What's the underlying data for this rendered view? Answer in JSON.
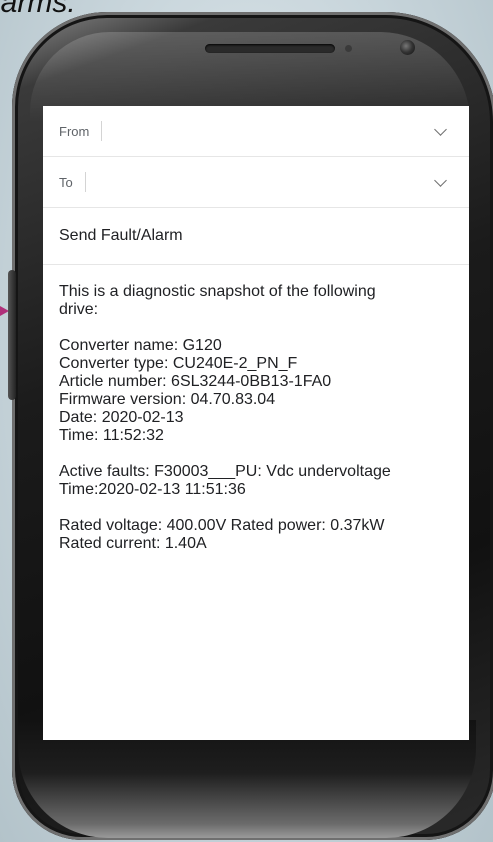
{
  "caption": "larms.",
  "email": {
    "from_label": "From",
    "to_label": "To",
    "subject": "Send Fault/Alarm",
    "body": {
      "intro_line1": "This is a diagnostic snapshot of the following",
      "intro_line2": "drive:",
      "converter_name": "Converter name: G120",
      "converter_type": "Converter type: CU240E-2_PN_F",
      "article_number": "Article number: 6SL3244-0BB13-1FA0",
      "firmware_version": "Firmware version: 04.70.83.04",
      "date": "Date: 2020-02-13",
      "time": "Time: 11:52:32",
      "active_faults": "Active faults: F30003___PU: Vdc undervoltage",
      "fault_time": "Time:2020-02-13 11:51:36",
      "rated_voltage_power": "Rated voltage: 400.00V Rated power: 0.37kW",
      "rated_current": "Rated current: 1.40A"
    }
  },
  "colors": {
    "background": "#c9d6dc",
    "phone_body": "#1b1b1b",
    "screen": "#ffffff",
    "label_text": "#5f6368",
    "body_text": "#202124",
    "arrow": "#b0307a"
  },
  "icons": {
    "from_expand": "chevron-down-icon",
    "to_expand": "chevron-down-icon"
  }
}
